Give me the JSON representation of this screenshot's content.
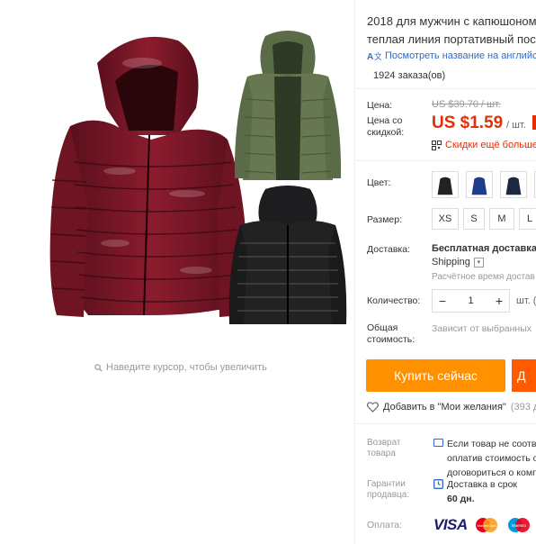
{
  "gallery": {
    "zoom_hint": "Наведите курсор, чтобы увеличить"
  },
  "product": {
    "title_line1": "2018 для мужчин с капюшоном",
    "title_line2": "теплая линия портативный пос",
    "translate_link": "Посмотреть название на английс",
    "orders": "1924 заказа(ов)"
  },
  "price": {
    "label": "Цена:",
    "old": "US $39.70 / шт.",
    "discount_label_1": "Цена со",
    "discount_label_2": "скидкой:",
    "new": "US $1.59",
    "per_unit": "/ шт.",
    "promo": "Скидки ещё больше"
  },
  "options": {
    "color_label": "Цвет:",
    "size_label": "Размер:",
    "sizes": [
      "XS",
      "S",
      "M",
      "L"
    ]
  },
  "shipping": {
    "label": "Доставка:",
    "line1": "Бесплатная доставка в",
    "line2": "Shipping",
    "line3": "Расчётное время достав"
  },
  "quantity": {
    "label": "Количество:",
    "value": "1",
    "minus": "−",
    "plus": "+",
    "unit": "шт. (("
  },
  "total": {
    "label_1": "Общая",
    "label_2": "стоимость:",
    "value": "Зависит от выбранных"
  },
  "actions": {
    "buy_now": "Купить сейчас",
    "add_to_cart": "Д",
    "wishlist": "Добавить в \"Мои желания\"",
    "wishlist_count": "(393 до"
  },
  "returns": {
    "label_1": "Возврат",
    "label_2": "товара",
    "line1": "Если товар не соотв",
    "line2": "оплатив стоимость о",
    "line3": "договориться о комп"
  },
  "guarantee": {
    "label_1": "Гарантии",
    "label_2": "продавца:",
    "line1": "Доставка в срок",
    "line2": "60 дн."
  },
  "payment": {
    "label": "Оплата:",
    "visa": "VISA",
    "mastercard": "MasterCard",
    "maestro": "Maestro"
  }
}
